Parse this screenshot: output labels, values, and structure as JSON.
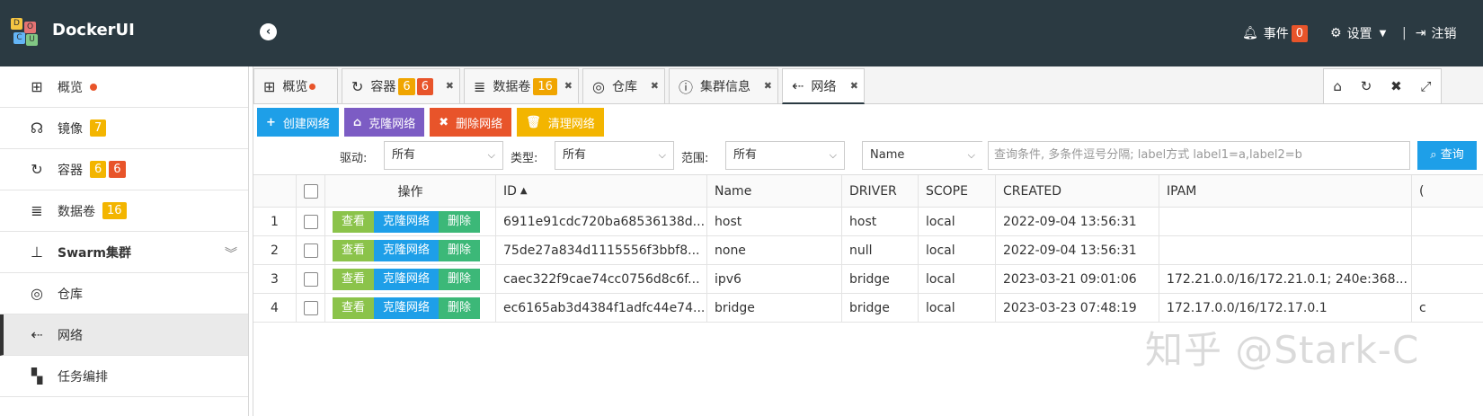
{
  "header": {
    "brand": "DockerUI",
    "logo_letters": [
      "D",
      "O",
      "C",
      "U"
    ],
    "collapse_icon": "chevron-left-circle-icon",
    "events_label": "事件",
    "events_count": "0",
    "settings_label": "设置",
    "logout_label": "注销"
  },
  "sidebar": {
    "items": [
      {
        "label": "概览",
        "icon": "windows-icon"
      },
      {
        "label": "镜像",
        "icon": "headphones-icon",
        "badge": "7"
      },
      {
        "label": "容器",
        "icon": "refresh-icon",
        "badge1": "6",
        "badge2": "6"
      },
      {
        "label": "数据卷",
        "icon": "database-icon",
        "badge": "16"
      },
      {
        "label": "Swarm集群",
        "icon": "sitemap-icon"
      },
      {
        "label": "仓库",
        "icon": "podcast-icon"
      },
      {
        "label": "网络",
        "icon": "usb-icon"
      },
      {
        "label": "任务编排",
        "icon": "checker-icon"
      }
    ]
  },
  "tabs": [
    {
      "label": "概览"
    },
    {
      "label": "容器",
      "badge1": "6",
      "badge2": "6"
    },
    {
      "label": "数据卷",
      "badge": "16"
    },
    {
      "label": "仓库"
    },
    {
      "label": "集群信息"
    },
    {
      "label": "网络"
    }
  ],
  "toolbar": {
    "create": "创建网络",
    "clone": "克隆网络",
    "delete": "删除网络",
    "clean": "清理网络"
  },
  "filters": {
    "driver_label": "驱动:",
    "driver_value": "所有",
    "type_label": "类型:",
    "type_value": "所有",
    "scope_label": "范围:",
    "scope_value": "所有",
    "field_value": "Name",
    "query_placeholder": "查询条件, 多条件逗号分隔; label方式 label1=a,label2=b",
    "search_label": "查询"
  },
  "table": {
    "headers": {
      "actions": "操作",
      "id": "ID",
      "name": "Name",
      "driver": "DRIVER",
      "scope": "SCOPE",
      "created": "CREATED",
      "ipam": "IPAM",
      "extra": "("
    },
    "action_labels": {
      "view": "查看",
      "clone": "克隆网络",
      "delete": "删除"
    },
    "rows": [
      {
        "num": "1",
        "id": "6911e91cdc720ba68536138d...",
        "name": "host",
        "driver": "host",
        "scope": "local",
        "created": "2022-09-04 13:56:31",
        "ipam": "",
        "extra": ""
      },
      {
        "num": "2",
        "id": "75de27a834d1115556f3bbf8...",
        "name": "none",
        "driver": "null",
        "scope": "local",
        "created": "2022-09-04 13:56:31",
        "ipam": "",
        "extra": ""
      },
      {
        "num": "3",
        "id": "caec322f9cae74cc0756d8c6f...",
        "name": "ipv6",
        "driver": "bridge",
        "scope": "local",
        "created": "2023-03-21 09:01:06",
        "ipam": "172.21.0.0/16/172.21.0.1; 240e:368...",
        "extra": ""
      },
      {
        "num": "4",
        "id": "ec6165ab3d4384f1adfc44e74...",
        "name": "bridge",
        "driver": "bridge",
        "scope": "local",
        "created": "2023-03-23 07:48:19",
        "ipam": "172.17.0.0/16/172.17.0.1",
        "extra": "c"
      }
    ]
  },
  "watermark": "知乎 @Stark-C",
  "colors": {
    "topbar": "#2b3a42",
    "create": "#1e9fe8",
    "clone": "#7c5cc4",
    "delete": "#e8542a",
    "clean": "#f3b500",
    "view": "#8bc34a",
    "row_clone": "#1e9fe8",
    "row_delete": "#3cb878"
  }
}
